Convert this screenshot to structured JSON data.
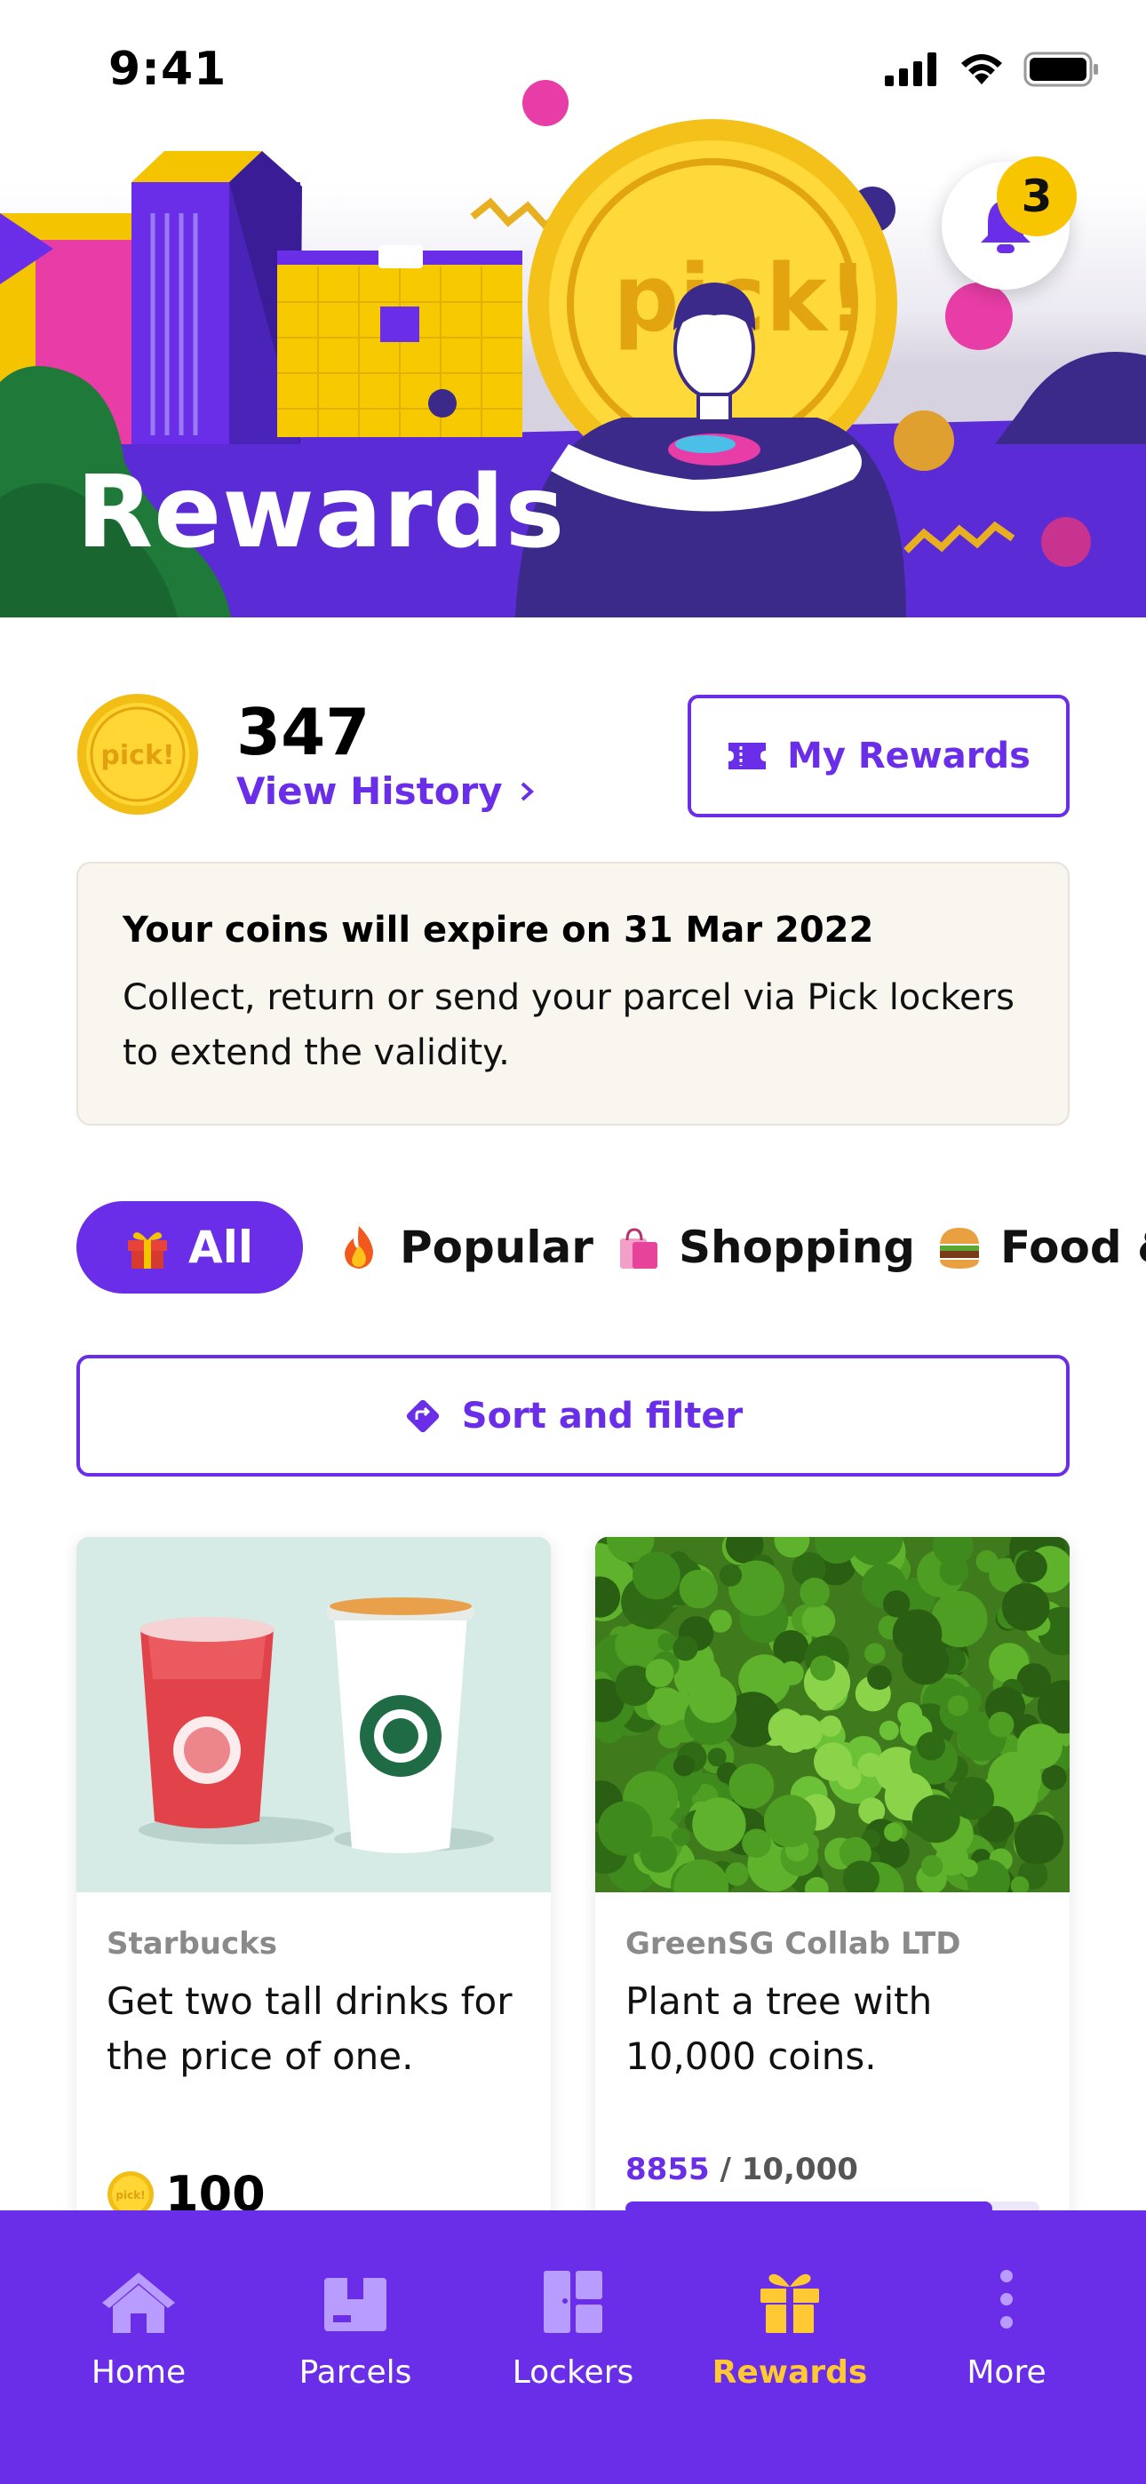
{
  "status_bar": {
    "time": "9:41"
  },
  "header": {
    "title": "Rewards",
    "notification_count": "3",
    "brand_mark": "pick!"
  },
  "coins": {
    "balance": "347",
    "view_history_label": "View History",
    "my_rewards_label": "My Rewards"
  },
  "notice": {
    "title": "Your coins will expire on 31 Mar 2022",
    "body": "Collect, return or send your parcel via Pick lockers to extend the validity."
  },
  "categories": [
    {
      "label": "All",
      "icon": "gift-emoji",
      "active": true
    },
    {
      "label": "Popular",
      "icon": "fire-emoji",
      "active": false
    },
    {
      "label": "Shopping",
      "icon": "shopping-bags-emoji",
      "active": false
    },
    {
      "label": "Food &",
      "icon": "burger-emoji",
      "active": false
    }
  ],
  "sort_filter_label": "Sort and filter",
  "rewards": [
    {
      "brand": "Starbucks",
      "description": "Get two tall drinks for the price of one.",
      "price": "100",
      "image": "starbucks-drinks-image"
    },
    {
      "brand": "GreenSG Collab LTD",
      "description": "Plant a tree with 10,000 coins.",
      "progress_current": "8855",
      "progress_total": "/ 10,000",
      "progress_fraction": 0.8855,
      "image": "forest-aerial-image"
    }
  ],
  "bottom_nav": [
    {
      "label": "Home",
      "icon": "home-icon",
      "active": false
    },
    {
      "label": "Parcels",
      "icon": "parcel-icon",
      "active": false
    },
    {
      "label": "Lockers",
      "icon": "locker-icon",
      "active": false
    },
    {
      "label": "Rewards",
      "icon": "gift-icon",
      "active": true
    },
    {
      "label": "More",
      "icon": "more-vertical-icon",
      "active": false
    }
  ],
  "colors": {
    "primary": "#6b2ee8",
    "accent_yellow": "#ffc933",
    "notice_bg": "#f9f5ef"
  }
}
